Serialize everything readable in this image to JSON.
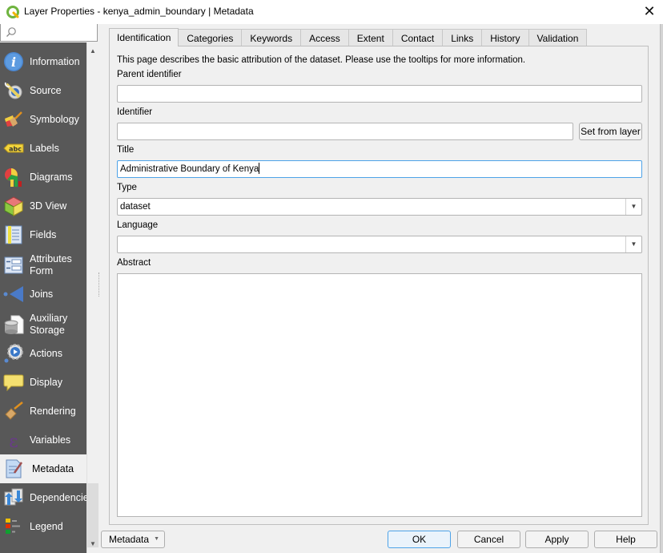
{
  "window": {
    "title": "Layer Properties - kenya_admin_boundary | Metadata",
    "close_label": "✕"
  },
  "search": {
    "placeholder": "",
    "value": ""
  },
  "sidebar": {
    "items": [
      {
        "label": "Information",
        "icon": "information-icon"
      },
      {
        "label": "Source",
        "icon": "source-icon"
      },
      {
        "label": "Symbology",
        "icon": "symbology-icon"
      },
      {
        "label": "Labels",
        "icon": "labels-icon"
      },
      {
        "label": "Diagrams",
        "icon": "diagrams-icon"
      },
      {
        "label": "3D View",
        "icon": "3d-view-icon"
      },
      {
        "label": "Fields",
        "icon": "fields-icon"
      },
      {
        "label": "Attributes\nForm",
        "icon": "attributes-form-icon"
      },
      {
        "label": "Joins",
        "icon": "joins-icon"
      },
      {
        "label": "Auxiliary\nStorage",
        "icon": "auxiliary-storage-icon"
      },
      {
        "label": "Actions",
        "icon": "actions-icon"
      },
      {
        "label": "Display",
        "icon": "display-icon"
      },
      {
        "label": "Rendering",
        "icon": "rendering-icon"
      },
      {
        "label": "Variables",
        "icon": "variables-icon"
      },
      {
        "label": "Metadata",
        "icon": "metadata-icon",
        "active": true
      },
      {
        "label": "Dependencies",
        "icon": "dependencies-icon"
      },
      {
        "label": "Legend",
        "icon": "legend-icon"
      }
    ]
  },
  "tabs": [
    {
      "label": "Identification",
      "active": true
    },
    {
      "label": "Categories"
    },
    {
      "label": "Keywords"
    },
    {
      "label": "Access"
    },
    {
      "label": "Extent"
    },
    {
      "label": "Contact"
    },
    {
      "label": "Links"
    },
    {
      "label": "History"
    },
    {
      "label": "Validation"
    }
  ],
  "identification": {
    "description": "This page describes the basic attribution of the dataset. Please use the tooltips for more information.",
    "parent_identifier": {
      "label": "Parent identifier",
      "value": ""
    },
    "identifier": {
      "label": "Identifier",
      "value": "",
      "set_from_layer_label": "Set from layer"
    },
    "title": {
      "label": "Title",
      "value": "Administrative Boundary of Kenya"
    },
    "type": {
      "label": "Type",
      "value": "dataset"
    },
    "language": {
      "label": "Language",
      "value": ""
    },
    "abstract": {
      "label": "Abstract",
      "value": ""
    }
  },
  "footer": {
    "style_menu_label": "Metadata",
    "ok_label": "OK",
    "cancel_label": "Cancel",
    "apply_label": "Apply",
    "help_label": "Help"
  },
  "colors": {
    "sidebar_bg": "#585858",
    "focus_border": "#4ea3e8",
    "qgis_green": "#6fb43f"
  }
}
